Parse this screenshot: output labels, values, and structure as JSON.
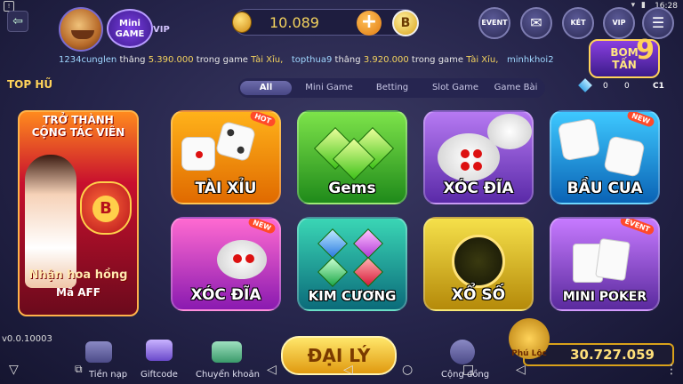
{
  "status_bar": {
    "time": "16:28"
  },
  "header": {
    "minigame": "Mini\nGAME",
    "vip_tag": "VIP",
    "balance": "10.089",
    "plus_icon": "+",
    "b_coin": "B",
    "buttons": [
      {
        "name": "event-button",
        "label": "EVENT"
      },
      {
        "name": "mail-button",
        "label": "✉"
      },
      {
        "name": "ket-button",
        "label": "KÉT"
      },
      {
        "name": "vip-button",
        "label": "VIP"
      },
      {
        "name": "menu-button",
        "label": "☰"
      }
    ]
  },
  "ticker": [
    {
      "user": "1234cunglen",
      "verb": "thắng",
      "amount": "5.390.000",
      "mid": "trong game",
      "game": "Tài Xỉu,"
    },
    {
      "user": "topthua9",
      "verb": "thắng",
      "amount": "3.920.000",
      "mid": "trong game",
      "game": "Tài Xỉu,"
    },
    {
      "user": "minhkhoi2",
      "verb": "",
      "amount": "",
      "mid": "",
      "game": ""
    }
  ],
  "bomtan": {
    "line1": "BOM",
    "line2": "TẤN",
    "num": "9"
  },
  "tophu": "TOP HŨ",
  "tabs": [
    "All",
    "Mini Game",
    "Betting",
    "Slot Game",
    "Game Bài"
  ],
  "jackpot_selector": {
    "v1": "0",
    "v2": "0",
    "room": "C1"
  },
  "promo": {
    "line1": "TRỞ THÀNH",
    "line2": "CỘNG TÁC VIÊN",
    "line3": "Nhận hoa hồng",
    "line4": "Mã AFF",
    "bag": "B"
  },
  "games": [
    {
      "label": "TÀI XỈU",
      "badge": "HOT"
    },
    {
      "label": "Gems",
      "badge": ""
    },
    {
      "label": "XÓC ĐĨA",
      "badge": ""
    },
    {
      "label": "BẦU CUA",
      "badge": "NEW"
    },
    {
      "label": "XÓC ĐĨA",
      "badge": "NEW"
    },
    {
      "label": "KIM CƯƠNG",
      "badge": ""
    },
    {
      "label": "XỔ SỐ",
      "badge": ""
    },
    {
      "label": "MINI POKER",
      "badge": "EVENT"
    }
  ],
  "version": "v0.0.10003",
  "bottom": {
    "naptien": "Tiền nạp",
    "giftcode": "Giftcode",
    "chuyenkhoan": "Chuyển khoản",
    "daily": "ĐẠI LÝ",
    "congdong": "Cộng đồng",
    "jackpot": "30.727.059",
    "fulloc": "Phú Lộc"
  }
}
